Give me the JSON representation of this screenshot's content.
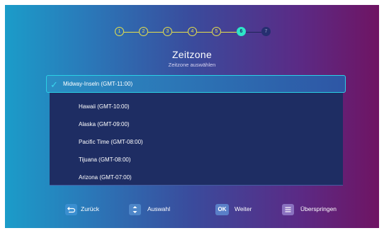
{
  "steps": [
    "1",
    "2",
    "3",
    "4",
    "5",
    "6",
    "7"
  ],
  "active_step": 6,
  "title": "Zeitzone",
  "subtitle": "Zeitzone auswählen",
  "list": {
    "selected_index": 0,
    "items": [
      "Midway-Inseln (GMT-11:00)",
      "Hawaii (GMT-10:00)",
      "Alaska (GMT-09:00)",
      "Pacific Time (GMT-08:00)",
      "Tijuana (GMT-08:00)",
      "Arizona (GMT-07:00)"
    ]
  },
  "footer": {
    "back_label": "Zurück",
    "select_label": "Auswahl",
    "ok_badge": "OK",
    "next_label": "Weiter",
    "skip_label": "Überspringen"
  },
  "colors": {
    "accent": "#2ee6c8",
    "step_done": "#e8e24a",
    "list_bg": "#1e2d63"
  }
}
